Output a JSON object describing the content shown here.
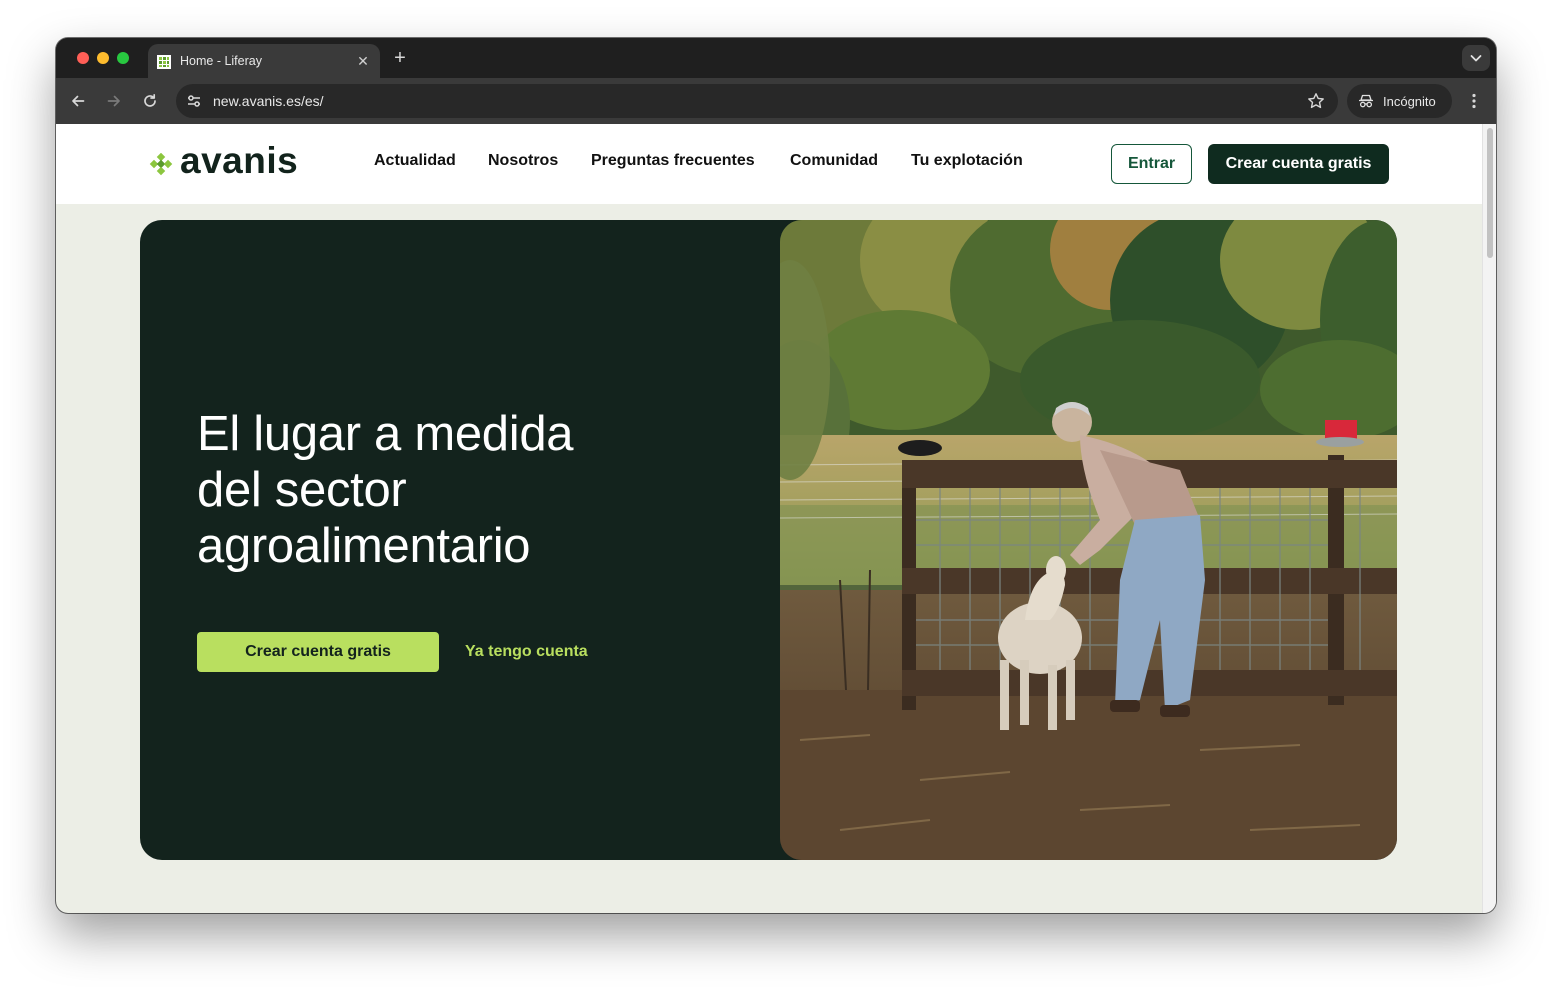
{
  "browser": {
    "tab_title": "Home - Liferay",
    "url": "new.avanis.es/es/",
    "incognito_label": "Incógnito"
  },
  "site": {
    "logo_text": "avanis",
    "nav": [
      "Actualidad",
      "Nosotros",
      "Preguntas frecuentes",
      "Comunidad",
      "Tu explotación"
    ],
    "login_label": "Entrar",
    "signup_label": "Crear cuenta gratis"
  },
  "hero": {
    "title_lines": [
      "El lugar a medida",
      "del sector",
      "agroalimentario"
    ],
    "cta_label": "Crear cuenta gratis",
    "secondary_link": "Ya tengo cuenta"
  },
  "colors": {
    "brand_dark": "#0f2b1f",
    "brand_green": "#15573a",
    "accent_lime": "#b9df5f",
    "hero_background": "#13231d",
    "page_background": "#eceee6"
  },
  "icons": [
    "close-icon",
    "plus-icon",
    "chevron-down-icon",
    "back-arrow-icon",
    "forward-arrow-icon",
    "reload-icon",
    "site-info-icon",
    "star-icon",
    "incognito-icon",
    "kebab-menu-icon"
  ]
}
